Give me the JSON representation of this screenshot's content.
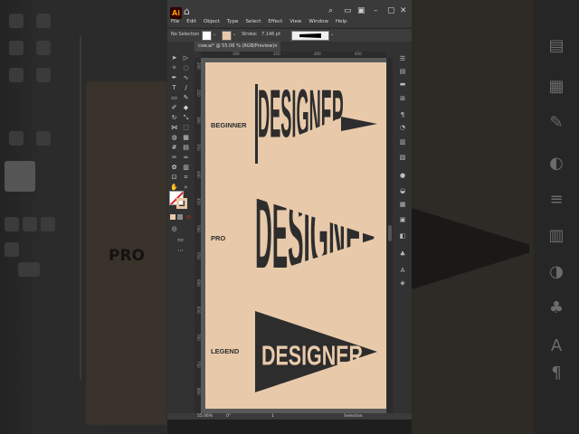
{
  "window": {
    "app_logo": "Ai",
    "menus": [
      "File",
      "Edit",
      "Object",
      "Type",
      "Select",
      "Effect",
      "View",
      "Window",
      "Help"
    ]
  },
  "control_bar": {
    "selection_label": "No Selection",
    "stroke_label": "Stroke:",
    "stroke_value": "7.146 pt"
  },
  "document_tab": {
    "title": "cow.ai* @ 55.06 % (RGB/Preview)",
    "close": "×"
  },
  "rulers": {
    "top": [
      "300",
      "350",
      "400",
      "450",
      "500"
    ],
    "left": [
      "200",
      "250",
      "300",
      "350",
      "400",
      "450",
      "500",
      "550",
      "600",
      "650",
      "700",
      "750",
      "800"
    ]
  },
  "artwork": {
    "background_color": "#e8caab",
    "ink_color": "#2d2d2d",
    "levels": [
      {
        "label": "BEGINNER",
        "word": "DESIGNER"
      },
      {
        "label": "PRO",
        "word": "DESIGNER"
      },
      {
        "label": "LEGEND",
        "word": "DESIGNER"
      }
    ]
  },
  "status_bar": {
    "zoom": "55.06%",
    "rotation": "0°",
    "artboard_nav": "1",
    "tool": "Selection"
  },
  "backdrop": {
    "left_text": "PRO"
  }
}
